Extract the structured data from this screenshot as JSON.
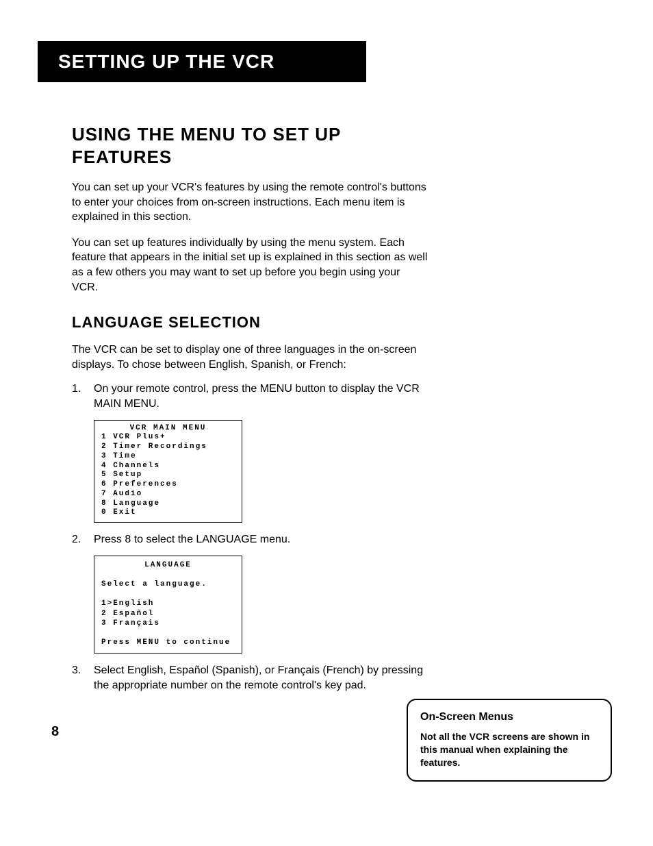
{
  "chapterTitle": "Setting Up the VCR",
  "sectionHeading": "Using the Menu to Set Up Features",
  "intro1": "You can set up your VCR's features by using the remote control's buttons to enter your choices from on-screen instructions. Each menu item is explained in this section.",
  "intro2": "You can set up features individually by using the menu system. Each feature that appears in the initial set up is explained in this section as well as a few others you may want to set up before you begin using your VCR.",
  "subheading": "Language Selection",
  "langIntro": "The VCR can be set to display one of three languages in the on-screen displays. To chose between English, Spanish, or French:",
  "step1Num": "1.",
  "step1Text": "On your remote control, press the MENU button to display the VCR MAIN MENU.",
  "mainMenu": {
    "title": "VCR MAIN MENU",
    "lines": [
      "1 VCR Plus+",
      "2 Timer Recordings",
      "3 Time",
      "4 Channels",
      "5 Setup",
      "6 Preferences",
      "7 Audio",
      "8 Language",
      "0 Exit"
    ]
  },
  "step2Num": "2.",
  "step2Text": "Press 8 to select the LANGUAGE menu.",
  "langMenu": {
    "title": "LANGUAGE",
    "prompt": "Select a language.",
    "options": [
      "1>English",
      "2 Español",
      "3 Français"
    ],
    "footer": "Press MENU to continue"
  },
  "step3Num": "3.",
  "step3Text": "Select English, Español (Spanish), or Français (French) by pressing the appropriate number on the remote control's key pad.",
  "noteTitle": "On-Screen Menus",
  "noteBody": "Not all the VCR screens are shown in this manual when explaining the features.",
  "pageNumber": "8"
}
